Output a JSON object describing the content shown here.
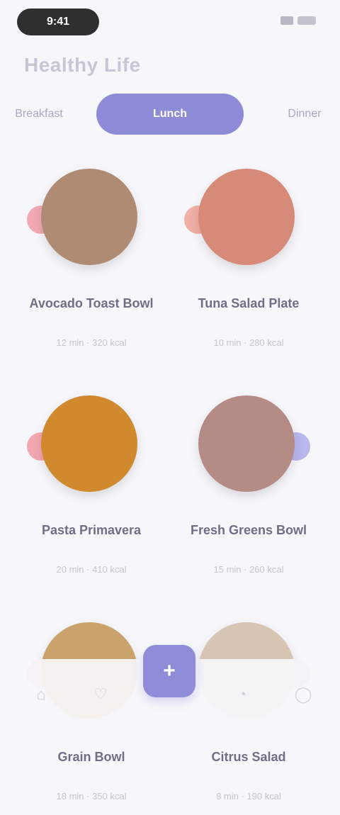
{
  "status_bar": {
    "time": "9:41",
    "signal_icon": "signal-icon",
    "battery_icon": "battery-icon"
  },
  "page": {
    "title": "Healthy Life"
  },
  "tabs": [
    {
      "label": "Breakfast",
      "active": false
    },
    {
      "label": "Lunch",
      "active": true
    },
    {
      "label": "Dinner",
      "active": false
    }
  ],
  "dishes": [
    {
      "name": "Avocado Toast Bowl",
      "meta": "12 min · 320 kcal",
      "plate_color": "#b08b74",
      "accent_color": "#f2a9b3"
    },
    {
      "name": "Tuna Salad Plate",
      "meta": "10 min · 280 kcal",
      "plate_color": "#d88a78",
      "accent_color": "#f1b0a6"
    },
    {
      "name": "Pasta Primavera",
      "meta": "20 min · 410 kcal",
      "plate_color": "#d08a2d",
      "accent_color": "#f2a7b0"
    },
    {
      "name": "Fresh Greens Bowl",
      "meta": "15 min · 260 kcal",
      "plate_color": "#b58b86",
      "accent_color": "#b8b7ee"
    },
    {
      "name": "Grain Bowl",
      "meta": "18 min · 350 kcal",
      "plate_color": "#c9a36b",
      "accent_color": "#f0b3bc"
    },
    {
      "name": "Citrus Salad",
      "meta": "8 min · 190 kcal",
      "plate_color": "#d6c5b3",
      "accent_color": "#b8b7ee"
    }
  ],
  "bottom_nav": {
    "items": [
      {
        "icon": "home-icon",
        "glyph": "⌂"
      },
      {
        "icon": "heart-icon",
        "glyph": "♡"
      },
      {
        "icon": "plus-icon",
        "glyph": "+"
      },
      {
        "icon": "bell-icon",
        "glyph": "◔"
      },
      {
        "icon": "user-icon",
        "glyph": "◯"
      }
    ]
  }
}
